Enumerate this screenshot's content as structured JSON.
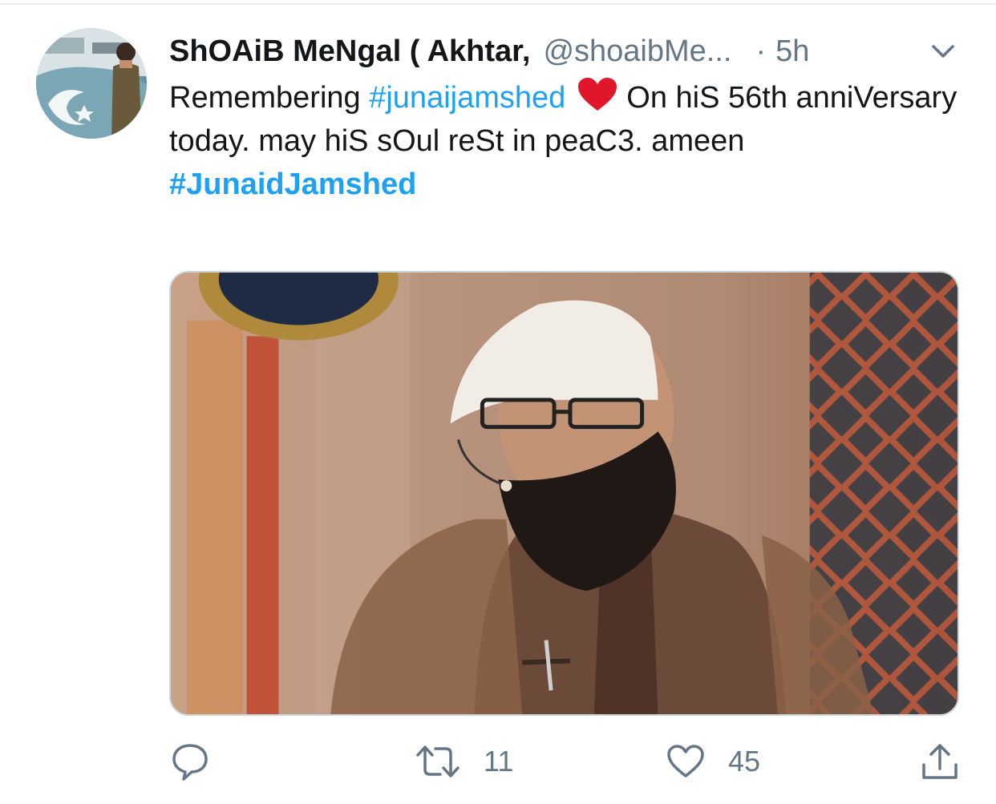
{
  "tweet": {
    "display_name": "ShOAiB MeNgal ( Akhtar,",
    "handle": "@shoaibMe...",
    "separator": "·",
    "time": "5h",
    "text": {
      "part1": "Remembering ",
      "hashtag1": "#junaijamshed",
      "emoji": "red-heart",
      "part2": "On hiS 56th anniVersary today. may hiS sOul reSt in peaC3. ameen",
      "hashtag2": "#JunaidJamshed"
    },
    "stats": {
      "replies": "",
      "retweets": "11",
      "likes": "45"
    }
  },
  "icons": {
    "more": "chevron-down-icon",
    "reply": "reply-icon",
    "retweet": "retweet-icon",
    "like": "heart-icon",
    "share": "share-icon"
  },
  "colors": {
    "link": "#1da1f2",
    "secondary_text": "#657786",
    "primary_text": "#14171a",
    "heart_emoji": "#e0162b"
  }
}
